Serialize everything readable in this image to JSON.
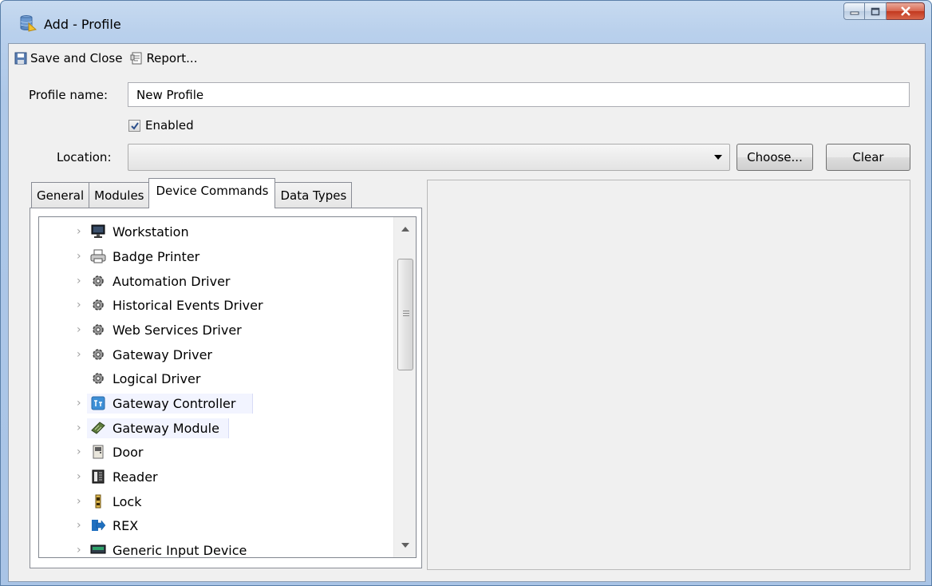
{
  "window": {
    "title": "Add - Profile",
    "icon": "database-icon",
    "controls": [
      "minimize-icon",
      "maximize-icon",
      "close-icon"
    ]
  },
  "toolbar": {
    "save_close_label": "Save and Close",
    "report_label": "Report..."
  },
  "form": {
    "profile_name_label": "Profile name:",
    "profile_name_value": "New Profile",
    "enabled_label": "Enabled",
    "enabled_checked": true,
    "location_label": "Location:",
    "location_value": "",
    "choose_label": "Choose...",
    "clear_label": "Clear"
  },
  "tabs": {
    "items": [
      "General",
      "Modules",
      "Device Commands",
      "Data Types"
    ],
    "active": "Device Commands"
  },
  "tree": {
    "items": [
      {
        "label": "Workstation",
        "icon": "monitor-icon",
        "expandable": true
      },
      {
        "label": "Badge Printer",
        "icon": "printer-icon",
        "expandable": true
      },
      {
        "label": "Automation Driver",
        "icon": "gear-icon",
        "expandable": true
      },
      {
        "label": "Historical Events Driver",
        "icon": "gear-icon",
        "expandable": true
      },
      {
        "label": "Web Services Driver",
        "icon": "gear-icon",
        "expandable": true
      },
      {
        "label": "Gateway Driver",
        "icon": "gear-icon",
        "expandable": true
      },
      {
        "label": "Logical Driver",
        "icon": "gear-icon",
        "expandable": false
      },
      {
        "label": "Gateway Controller",
        "icon": "controller-icon",
        "expandable": true,
        "highlighted": true
      },
      {
        "label": "Gateway Module",
        "icon": "module-board-icon",
        "expandable": true,
        "highlighted": true
      },
      {
        "label": "Door",
        "icon": "door-icon",
        "expandable": true
      },
      {
        "label": "Reader",
        "icon": "reader-icon",
        "expandable": true
      },
      {
        "label": "Lock",
        "icon": "lock-icon",
        "expandable": true
      },
      {
        "label": "REX",
        "icon": "exit-arrow-icon",
        "expandable": true
      },
      {
        "label": "Generic Input Device",
        "icon": "input-device-icon",
        "expandable": true
      }
    ]
  },
  "colors": {
    "frame": "#aec8e8",
    "client": "#f0f0f0",
    "close_button": "#c8452c",
    "highlight": "#f2f4ff"
  }
}
